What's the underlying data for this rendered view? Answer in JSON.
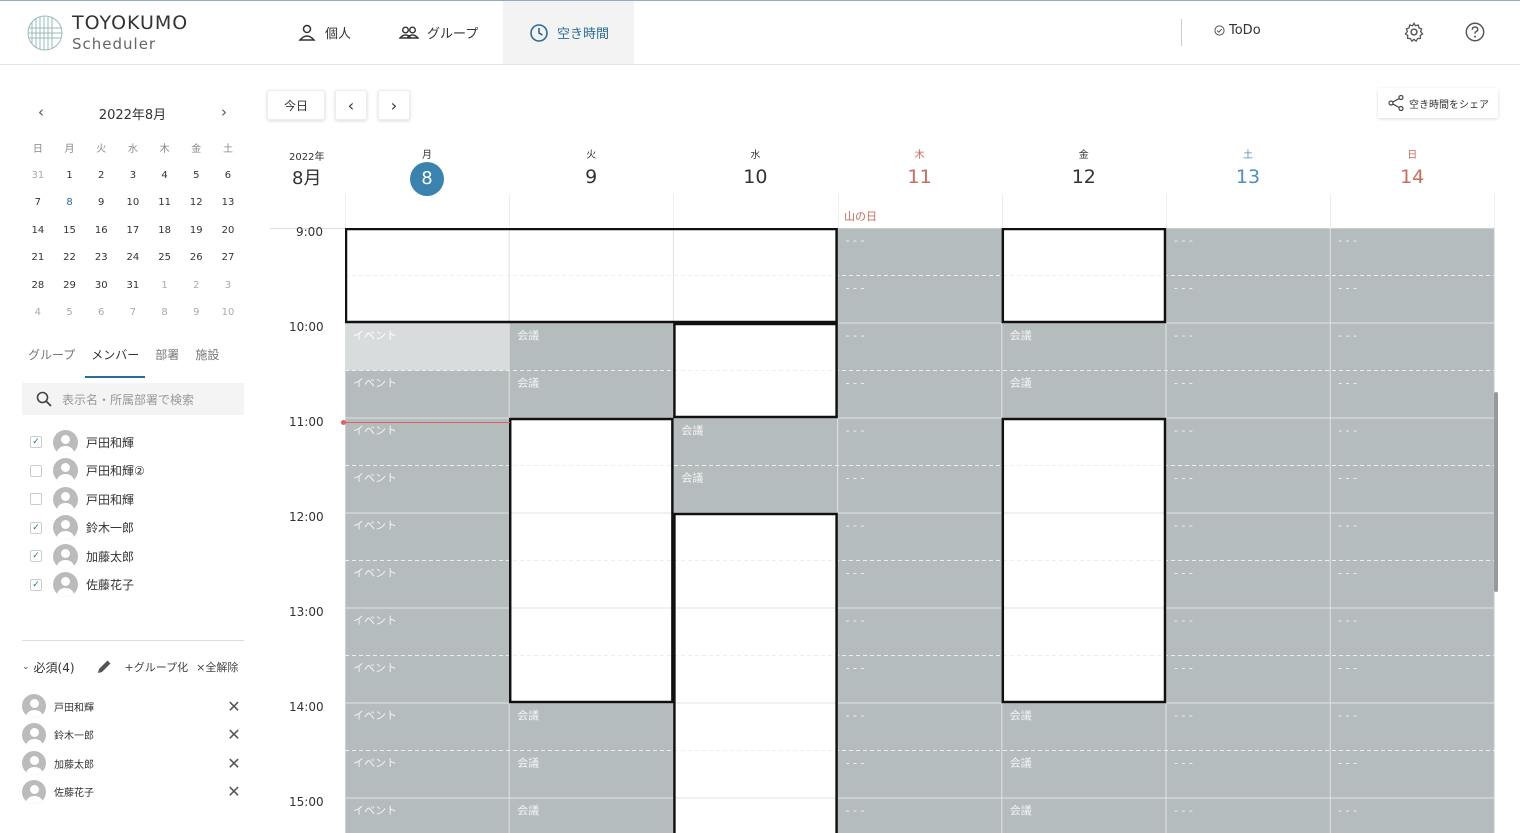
{
  "app": {
    "brand_title": "TOYOKUMO",
    "brand_sub": "Scheduler"
  },
  "nav": {
    "tabs": [
      {
        "label": "個人",
        "icon": "person-icon"
      },
      {
        "label": "グループ",
        "icon": "group-icon"
      },
      {
        "label": "空き時間",
        "icon": "clock-icon",
        "active": true
      }
    ],
    "todo_label": "ToDo"
  },
  "mini_cal": {
    "title": "2022年8月",
    "dow": [
      "日",
      "月",
      "火",
      "水",
      "木",
      "金",
      "土"
    ],
    "weeks": [
      [
        "31",
        "1",
        "2",
        "3",
        "4",
        "5",
        "6"
      ],
      [
        "7",
        "8",
        "9",
        "10",
        "11",
        "12",
        "13"
      ],
      [
        "14",
        "15",
        "16",
        "17",
        "18",
        "19",
        "20"
      ],
      [
        "21",
        "22",
        "23",
        "24",
        "25",
        "26",
        "27"
      ],
      [
        "28",
        "29",
        "30",
        "31",
        "1",
        "2",
        "3"
      ],
      [
        "4",
        "5",
        "6",
        "7",
        "8",
        "9",
        "10"
      ]
    ],
    "today": "8"
  },
  "side_tabs": [
    "グループ",
    "メンバー",
    "部署",
    "施設"
  ],
  "search": {
    "placeholder": "表示名・所属部署で検索"
  },
  "members": [
    {
      "name": "戸田和輝",
      "checked": true
    },
    {
      "name": "戸田和輝②",
      "checked": false
    },
    {
      "name": "戸田和輝",
      "checked": false
    },
    {
      "name": "鈴木一郎",
      "checked": true
    },
    {
      "name": "加藤太郎",
      "checked": true
    },
    {
      "name": "佐藤花子",
      "checked": true
    }
  ],
  "required": {
    "title": "必須(4)",
    "group_label": "+グループ化",
    "clear_label": "×全解除",
    "items": [
      "戸田和輝",
      "鈴木一郎",
      "加藤太郎",
      "佐藤花子"
    ]
  },
  "toolbar": {
    "today_label": "今日",
    "share_label": "空き時間をシェア"
  },
  "week": {
    "year": "2022年",
    "month": "8月",
    "days": [
      {
        "dow": "月",
        "num": "8",
        "today": true
      },
      {
        "dow": "火",
        "num": "9"
      },
      {
        "dow": "水",
        "num": "10"
      },
      {
        "dow": "木",
        "num": "11",
        "color": "red"
      },
      {
        "dow": "金",
        "num": "12"
      },
      {
        "dow": "土",
        "num": "13",
        "color": "blue"
      },
      {
        "dow": "日",
        "num": "14",
        "color": "red"
      }
    ],
    "holiday_label": "山の日",
    "times": [
      "9:00",
      "10:00",
      "11:00",
      "12:00",
      "13:00",
      "14:00",
      "15:00"
    ]
  },
  "events": {
    "event_label": "イベント",
    "meeting_label": "会議",
    "none_label": "- - -"
  },
  "colors": {
    "accent": "#2a6d96",
    "busy": "#b4bcbe",
    "event_light": "#d9dcdd",
    "holiday": "#d06a5a",
    "saturday": "#4e8fc0"
  }
}
